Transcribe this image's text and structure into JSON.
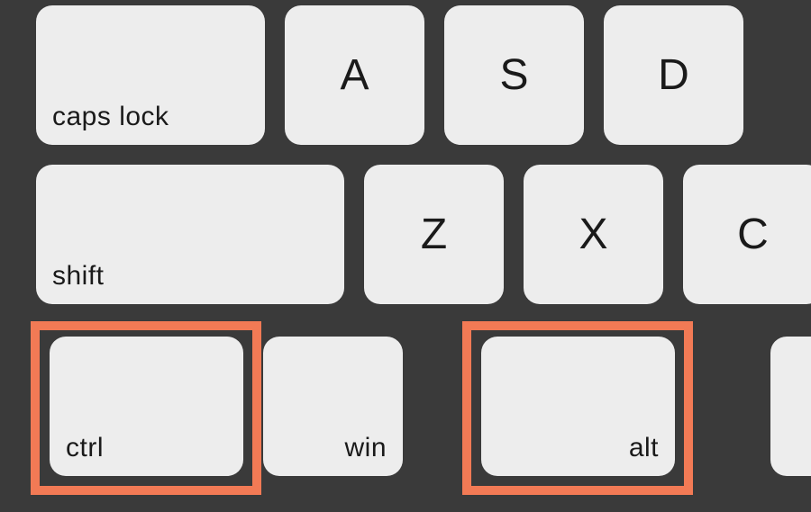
{
  "keys": {
    "capslock": {
      "label": "caps lock"
    },
    "a": {
      "label": "A"
    },
    "s": {
      "label": "S"
    },
    "d": {
      "label": "D"
    },
    "shift": {
      "label": "shift"
    },
    "z": {
      "label": "Z"
    },
    "x": {
      "label": "X"
    },
    "c": {
      "label": "C"
    },
    "ctrl": {
      "label": "ctrl",
      "highlighted": true
    },
    "win": {
      "label": "win"
    },
    "alt": {
      "label": "alt",
      "highlighted": true
    },
    "space": {
      "label": ""
    }
  },
  "highlight_color": "#f27a55",
  "key_color": "#ededed",
  "background_color": "#3a3a3a"
}
